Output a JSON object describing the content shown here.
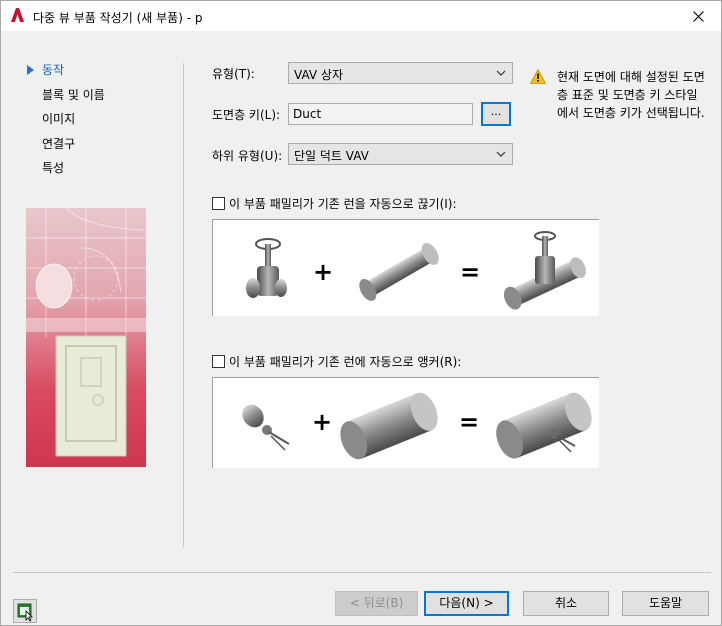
{
  "window": {
    "title": "다중 뷰 부품 작성기 (새 부품) - p",
    "colors": {
      "accent": "#0078d7",
      "app_icon_red": "#c8102e",
      "warning_yellow": "#f4c20d"
    }
  },
  "nav": {
    "items": [
      {
        "label": "동작",
        "active": true
      },
      {
        "label": "블록 및 이름",
        "active": false
      },
      {
        "label": "이미지",
        "active": false
      },
      {
        "label": "연결구",
        "active": false
      },
      {
        "label": "특성",
        "active": false
      }
    ]
  },
  "form": {
    "type_label": "유형(T):",
    "type_value": "VAV 상자",
    "layer_key_label": "도면층 키(L):",
    "layer_key_value": "Duct",
    "browse_label": "...",
    "subtype_label": "하위 유형(U):",
    "subtype_value": "단일 덕트 VAV"
  },
  "warning": {
    "icon": "warning-triangle-icon",
    "text": "현재 도면에 대해 설정된 도면층 표준 및 도면층 키 스타일에서 도면층 키가 선택됩니다."
  },
  "options": {
    "break_label": "이 부품 패밀리가 기존 런을 자동으로 끊기(I):",
    "break_checked": false,
    "anchor_label": "이 부품 패밀리가 기존 런에 자동으로 앵커(R):",
    "anchor_checked": false,
    "plus": "+",
    "equals": "="
  },
  "buttons": {
    "back": "< 뒤로(B)",
    "next": "다음(N) >",
    "cancel": "취소",
    "help": "도움말"
  }
}
